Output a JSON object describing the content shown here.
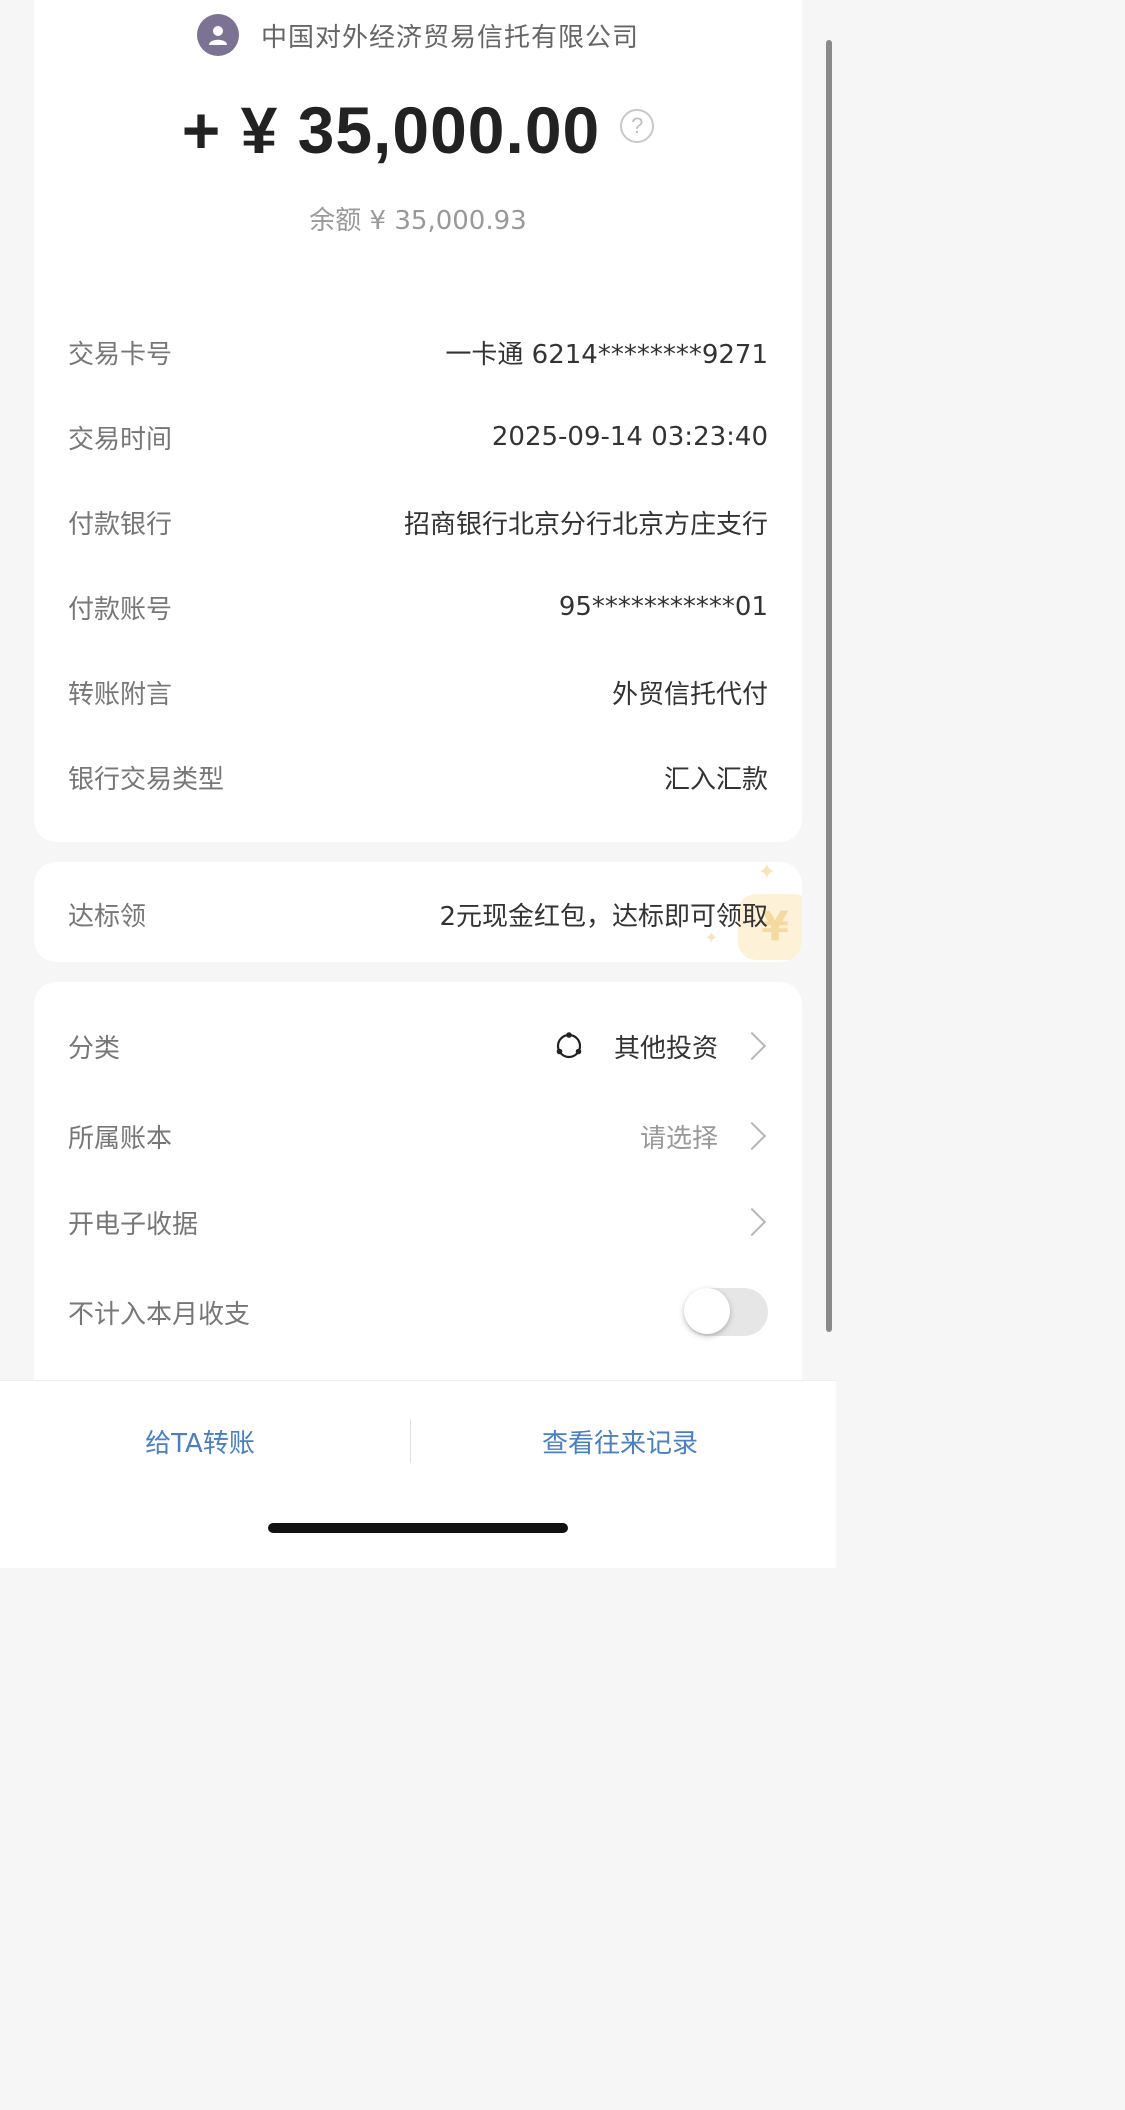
{
  "header": {
    "payer_name": "中国对外经济贸易信托有限公司",
    "amount": "+ ¥ 35,000.00",
    "balance": "余额 ¥ 35,000.93",
    "help_icon": "question-circle-icon",
    "avatar_icon": "person-avatar-icon"
  },
  "details": [
    {
      "label": "交易卡号",
      "value": "一卡通 6214********9271"
    },
    {
      "label": "交易时间",
      "value": "2025-09-14 03:23:40"
    },
    {
      "label": "付款银行",
      "value": "招商银行北京分行北京方庄支行"
    },
    {
      "label": "付款账号",
      "value": "95***********01"
    },
    {
      "label": "转账附言",
      "value": "外贸信托代付"
    },
    {
      "label": "银行交易类型",
      "value": "汇入汇款"
    }
  ],
  "reward": {
    "label": "达标领",
    "value": "2元现金红包，达标即可领取",
    "deco_glyph": "¥"
  },
  "settings": {
    "category": {
      "label": "分类",
      "value": "其他投资",
      "icon": "category-cycle-icon"
    },
    "ledger": {
      "label": "所属账本",
      "value": "请选择"
    },
    "receipt": {
      "label": "开电子收据"
    },
    "exclude": {
      "label": "不计入本月收支",
      "toggle_on": false
    }
  },
  "bottom_bar": {
    "transfer_label": "给TA转账",
    "history_label": "查看往来记录"
  },
  "colors": {
    "accent_link": "#4a7fc1",
    "avatar_bg": "#7b7294",
    "page_bg": "#f6f6f6"
  }
}
